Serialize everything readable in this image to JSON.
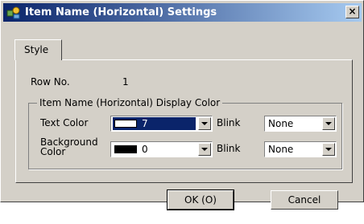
{
  "window": {
    "title": "Item Name (Horizontal) Settings",
    "close": "×"
  },
  "tabs": [
    {
      "label": "Style"
    }
  ],
  "row": {
    "label": "Row No.",
    "value": "1"
  },
  "group": {
    "legend": "Item Name (Horizontal) Display Color",
    "text_color": {
      "label": "Text Color",
      "value": "7",
      "swatch": "#ffffff"
    },
    "text_blink": {
      "label": "Blink",
      "value": "None"
    },
    "background_color": {
      "label_line1": "Background",
      "label_line2": "Color",
      "value": "0",
      "swatch": "#000000"
    },
    "background_blink": {
      "label": "Blink",
      "value": "None"
    }
  },
  "buttons": {
    "ok": "OK (O)",
    "cancel": "Cancel"
  }
}
